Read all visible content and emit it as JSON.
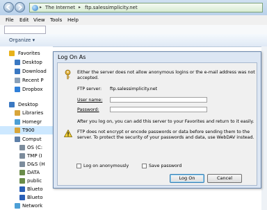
{
  "address_bar": {
    "crumbs": [
      "The Internet",
      "ftp.salessimplicity.net"
    ]
  },
  "menu": [
    "File",
    "Edit",
    "View",
    "Tools",
    "Help"
  ],
  "command_bar": {
    "organize_label": "Organize ▾"
  },
  "nav_pane": {
    "items": [
      {
        "label": "Favorites",
        "icon": "star-icon",
        "color": "#e8b21a"
      },
      {
        "label": "Desktop",
        "icon": "desktop-icon",
        "color": "#3a78c2"
      },
      {
        "label": "Download",
        "icon": "downloads-icon",
        "color": "#3a78c2"
      },
      {
        "label": "Recent P",
        "icon": "recent-places-icon",
        "color": "#8aa0b8"
      },
      {
        "label": "Dropbox",
        "icon": "dropbox-icon",
        "color": "#2f7fd8"
      },
      {
        "label": "Desktop",
        "icon": "desktop-icon",
        "color": "#3a78c2"
      },
      {
        "label": "Libraries",
        "icon": "libraries-icon",
        "color": "#d8a53a"
      },
      {
        "label": "Homegr",
        "icon": "homegroup-icon",
        "color": "#4c9fd6"
      },
      {
        "label": "T900",
        "icon": "user-folder-icon",
        "color": "#d8a53a"
      },
      {
        "label": "Comput",
        "icon": "computer-icon",
        "color": "#5d7fa8"
      },
      {
        "label": "OS (C:",
        "icon": "drive-icon",
        "color": "#7c8c9c"
      },
      {
        "label": "TMP (I",
        "icon": "drive-icon",
        "color": "#7c8c9c"
      },
      {
        "label": "D&S (H",
        "icon": "drive-icon",
        "color": "#7c8c9c"
      },
      {
        "label": "DATA",
        "icon": "network-drive-icon",
        "color": "#6a8c4a"
      },
      {
        "label": "public",
        "icon": "network-drive-icon",
        "color": "#6a8c4a"
      },
      {
        "label": "Blueto",
        "icon": "bluetooth-icon",
        "color": "#2a5fb8"
      },
      {
        "label": "Blueto",
        "icon": "bluetooth-icon",
        "color": "#2a5fb8"
      },
      {
        "label": "Network",
        "icon": "network-icon",
        "color": "#4c9fd6"
      }
    ]
  },
  "dialog": {
    "title": "Log On As",
    "intro_line1": "Either the server does not allow anonymous logins or the e-mail address was not",
    "intro_line2": "accepted.",
    "ftp_server_label": "FTP server:",
    "ftp_server_value": "ftp.salessimplicity.net",
    "username_label": "User name:",
    "username_value": "",
    "password_label": "Password:",
    "password_value": "",
    "after_logon_text": "After you log on, you can add this server to your Favorites and return to it easily.",
    "warning_line1": "FTP does not encrypt or encode passwords or data before sending them to the",
    "warning_line2": "server.  To protect the security of your passwords and data, use WebDAV instead.",
    "anon_label": "Log on anonymously",
    "save_label": "Save password",
    "logon_button": "Log On",
    "cancel_button": "Cancel"
  }
}
